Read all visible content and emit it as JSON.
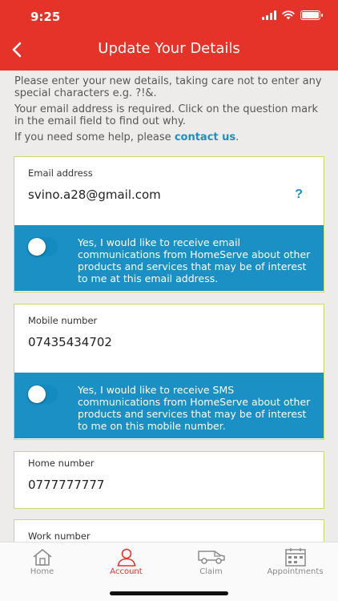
{
  "status_bar": {
    "time": "9:25"
  },
  "header": {
    "title": "Update Your Details"
  },
  "intro": {
    "line1": "Please enter your new details, taking care not to enter any special characters e.g. ?!&.",
    "line2": "Your email address is required. Click on the question mark in the email field to find out why.",
    "line3_prefix": "If you need some help, please ",
    "line3_link": "contact us",
    "line3_suffix": "."
  },
  "email": {
    "label": "Email address",
    "value": "svino.a28@gmail.com",
    "help": "?",
    "optin_text": "Yes, I would like to receive email communications from HomeServe about other products and services that may be of interest to me at this email address.",
    "optin_on": false
  },
  "mobile": {
    "label": "Mobile number",
    "value": "07435434702",
    "optin_text": "Yes, I would like to receive SMS communications from HomeServe about other products and services that may be of interest to me on this mobile number.",
    "optin_on": false
  },
  "home": {
    "label": "Home number",
    "value": "0777777777"
  },
  "work": {
    "label": "Work number"
  },
  "tabs": [
    {
      "label": "Home",
      "icon": "house-icon"
    },
    {
      "label": "Account",
      "icon": "person-icon",
      "active": true
    },
    {
      "label": "Claim",
      "icon": "van-icon"
    },
    {
      "label": "Appointments",
      "icon": "calendar-icon"
    }
  ],
  "colors": {
    "brand_red": "#e6332a",
    "accent_blue": "#1b90c4",
    "field_border": "#c9d96a"
  }
}
